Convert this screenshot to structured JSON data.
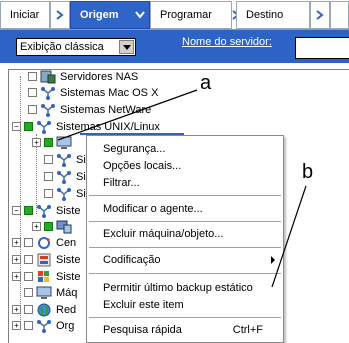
{
  "tabs": [
    {
      "label": "Iniciar",
      "active": false
    },
    {
      "label": "Origem",
      "active": true
    },
    {
      "label": "Programar",
      "active": false
    },
    {
      "label": "Destino",
      "active": false
    }
  ],
  "toolbar": {
    "view_select_value": "Exibição clássica",
    "server_name_label": "Nome do servidor:",
    "server_name_value": ""
  },
  "tree": {
    "items": [
      {
        "label": "Servidores NAS",
        "icon": "nas-server-icon"
      },
      {
        "label": "Sistemas Mac OS X",
        "icon": "network-icon"
      },
      {
        "label": "Sistemas NetWare",
        "icon": "network-icon"
      },
      {
        "label": "Sistemas UNIX/Linux",
        "icon": "network-icon"
      },
      {
        "label": "",
        "icon": "computer-icon"
      },
      {
        "label": "Siste",
        "icon": "network-icon"
      },
      {
        "label": "Siste",
        "icon": "network-icon"
      },
      {
        "label": "Siste",
        "icon": "network-icon"
      },
      {
        "label": "Siste",
        "icon": "network-icon"
      },
      {
        "label": "",
        "icon": "windows-computer-icon"
      },
      {
        "label": "Cen",
        "icon": "refresh-icon"
      },
      {
        "label": "Siste",
        "icon": "database-icon"
      },
      {
        "label": "Siste",
        "icon": "windows-flag-icon"
      },
      {
        "label": "Máq",
        "icon": "computer-icon"
      },
      {
        "label": "Red",
        "icon": "globe-icon"
      },
      {
        "label": "Org",
        "icon": "network-icon"
      }
    ]
  },
  "context_menu": {
    "items": [
      {
        "label": "Segurança..."
      },
      {
        "label": "Opções locais..."
      },
      {
        "label": "Filtrar..."
      },
      {
        "label": "Modificar o agente..."
      },
      {
        "label": "Excluir máquina/objeto..."
      },
      {
        "label": "Codificação"
      },
      {
        "label": "Permitir último backup estático"
      },
      {
        "label": "Excluir este item"
      },
      {
        "label": "Pesquisa rápida",
        "shortcut": "Ctrl+F"
      }
    ]
  },
  "callouts": {
    "a": "a",
    "b": "b"
  },
  "colors": {
    "accent": "#2f64c8",
    "toolbar": "#2d63c4",
    "check_green": "#22aa22"
  }
}
